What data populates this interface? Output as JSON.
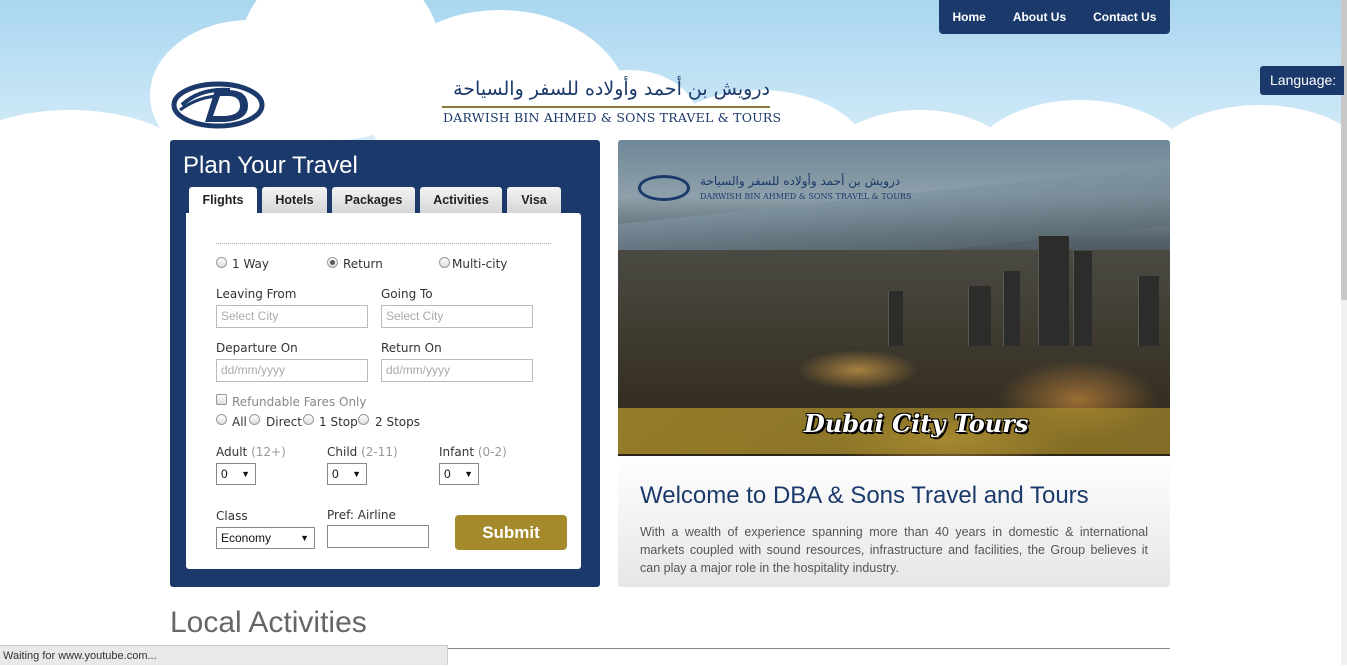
{
  "nav": {
    "home": "Home",
    "about": "About Us",
    "contact": "Contact Us"
  },
  "language_label": "Language:",
  "logo": {
    "arabic": "درويش بن أحمد وأولاده للسفر والسياحة",
    "english": "DARWISH BIN AHMED & SONS TRAVEL & TOURS"
  },
  "planner": {
    "title": "Plan Your Travel",
    "tabs": [
      "Flights",
      "Hotels",
      "Packages",
      "Activities",
      "Visa"
    ],
    "trip_types": [
      "1 Way",
      "Return",
      "Multi-city"
    ],
    "selected_trip_type": "Return",
    "leaving_from": {
      "label": "Leaving From",
      "placeholder": "Select City"
    },
    "going_to": {
      "label": "Going To",
      "placeholder": "Select City"
    },
    "departure": {
      "label": "Departure On",
      "placeholder": "dd/mm/yyyy"
    },
    "return": {
      "label": "Return On",
      "placeholder": "dd/mm/yyyy"
    },
    "refundable": "Refundable Fares Only",
    "stops": [
      "All",
      "Direct",
      "1 Stop",
      "2 Stops"
    ],
    "adult": {
      "label": "Adult",
      "range": "(12+)",
      "value": "0"
    },
    "child": {
      "label": "Child",
      "range": "(2-11)",
      "value": "0"
    },
    "infant": {
      "label": "Infant",
      "range": "(0-2)",
      "value": "0"
    },
    "class": {
      "label": "Class",
      "value": "Economy"
    },
    "pref_airline": {
      "label": "Pref: Airline",
      "value": ""
    },
    "submit": "Submit"
  },
  "hero": {
    "logo_arabic": "درويش بن أحمد وأولاده للسفر والسياحة",
    "logo_english": "DARWISH BIN AHMED & SONS TRAVEL & TOURS",
    "caption": "Dubai City Tours"
  },
  "welcome": {
    "title": "Welcome to DBA & Sons Travel and Tours",
    "body": "With a wealth of experience spanning more than 40 years in domestic & international markets coupled with sound resources, infrastructure and facilities, the Group believes it can play a major role in the hospitality industry."
  },
  "local_activities": "Local Activities",
  "status_bar": "Waiting for www.youtube.com...",
  "colors": {
    "brand_navy": "#1b3a6b",
    "gold": "#a58a2c"
  }
}
